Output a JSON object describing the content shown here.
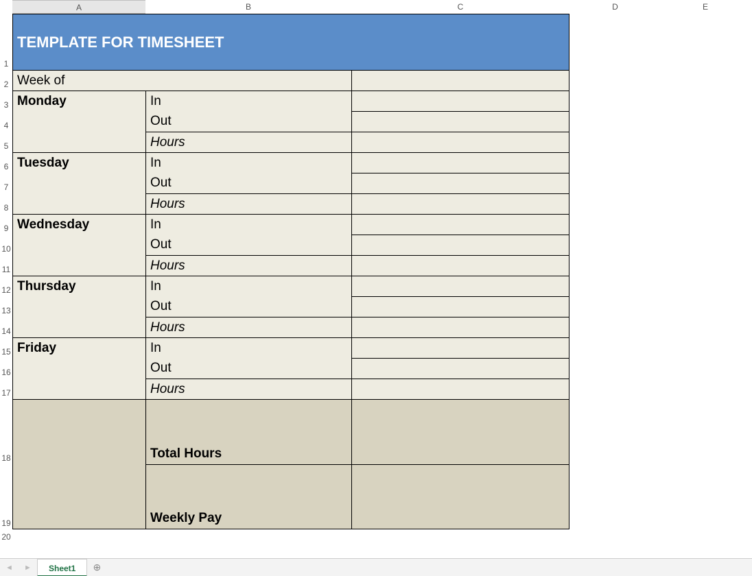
{
  "columns": {
    "A": "A",
    "B": "B",
    "C": "C",
    "D": "D",
    "E": "E"
  },
  "row_numbers": [
    "1",
    "2",
    "3",
    "4",
    "5",
    "6",
    "7",
    "8",
    "9",
    "10",
    "11",
    "12",
    "13",
    "14",
    "15",
    "16",
    "17",
    "18",
    "19",
    "20"
  ],
  "title": "TEMPLATE FOR TIMESHEET",
  "week_of_label": "Week of",
  "days": [
    {
      "name": "Monday",
      "in": "In",
      "out": "Out",
      "hours": "Hours"
    },
    {
      "name": "Tuesday",
      "in": "In",
      "out": "Out",
      "hours": "Hours"
    },
    {
      "name": "Wednesday",
      "in": "In",
      "out": "Out",
      "hours": "Hours"
    },
    {
      "name": "Thursday",
      "in": "In",
      "out": "Out",
      "hours": "Hours"
    },
    {
      "name": "Friday",
      "in": "In",
      "out": "Out",
      "hours": "Hours"
    }
  ],
  "summary": {
    "total_hours": "Total Hours",
    "weekly_pay": "Weekly Pay"
  },
  "sheet_tab": "Sheet1"
}
